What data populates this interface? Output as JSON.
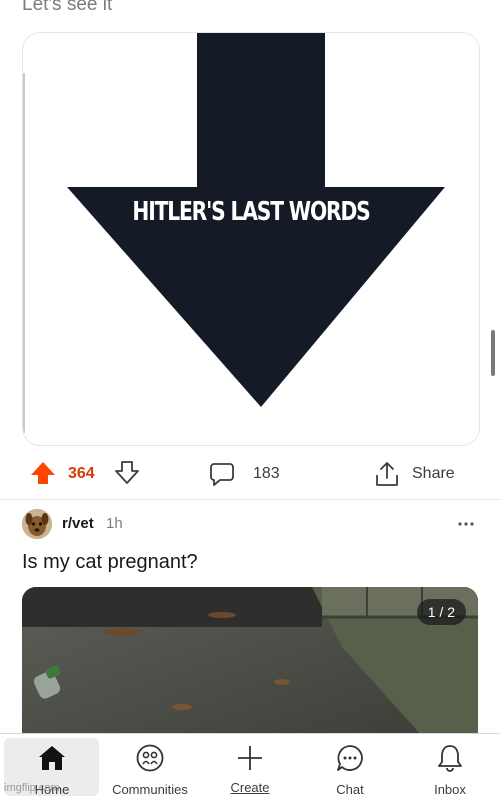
{
  "previous_post": {
    "title": "Let's see it"
  },
  "meme": {
    "caption": "HITLER'S LAST WORDS"
  },
  "actions": {
    "vote_count": "364",
    "comment_count": "183",
    "share_label": "Share"
  },
  "post": {
    "subreddit": "r/vet",
    "age": "1h",
    "title": "Is my cat pregnant?",
    "image_counter": "1 / 2"
  },
  "nav": {
    "home": "Home",
    "communities": "Communities",
    "create": "Create",
    "chat": "Chat",
    "inbox": "Inbox"
  },
  "watermark": "imgflip.com",
  "colors": {
    "upvote_active": "#ff4500",
    "vote_count": "#d93a00",
    "meme_arrow": "#151b26"
  }
}
